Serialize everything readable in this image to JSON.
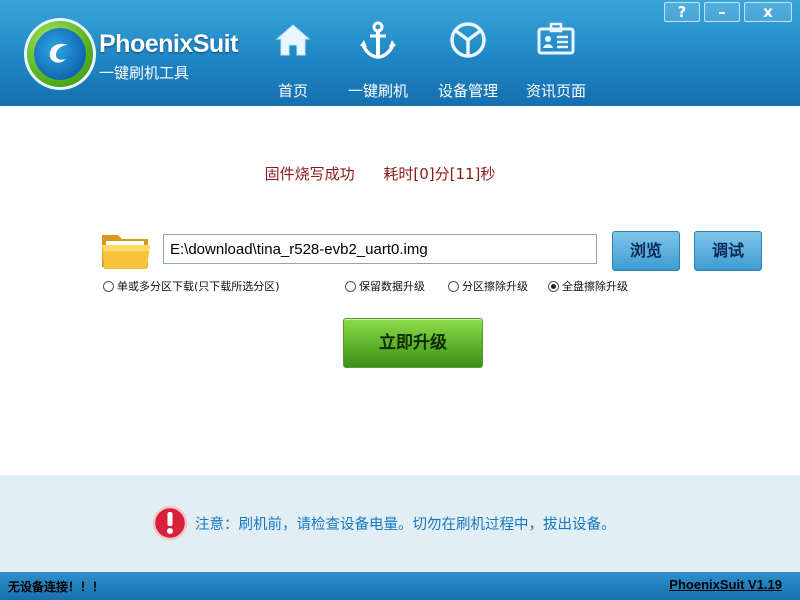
{
  "window": {
    "help_label": "?",
    "minimize_label": "–",
    "close_label": "x"
  },
  "brand": {
    "name": "PhoenixSuit",
    "subtitle": "一键刷机工具"
  },
  "nav": {
    "items": [
      {
        "label": "首页",
        "icon": "home-icon"
      },
      {
        "label": "一键刷机",
        "icon": "anchor-icon"
      },
      {
        "label": "设备管理",
        "icon": "device-icon"
      },
      {
        "label": "资讯页面",
        "icon": "news-icon"
      }
    ]
  },
  "status": {
    "result": "固件烧写成功",
    "elapsed": "耗时[0]分[11]秒",
    "color": "#8b1a1a"
  },
  "firmware": {
    "path": "E:\\download\\tina_r528-evb2_uart0.img",
    "browse_label": "浏览",
    "debug_label": "调试"
  },
  "options": {
    "partition_download": {
      "label": "单或多分区下载(只下载所选分区)",
      "checked": false
    },
    "keep_data": {
      "label": "保留数据升级",
      "checked": false
    },
    "partition_erase": {
      "label": "分区擦除升级",
      "checked": false
    },
    "full_erase": {
      "label": "全盘擦除升级",
      "checked": true
    }
  },
  "upgrade": {
    "label": "立即升级"
  },
  "notice": {
    "text": "注意：刷机前，请检查设备电量。切勿在刷机过程中，拔出设备。"
  },
  "footer": {
    "device_status": "无设备连接！！！",
    "version": "PhoenixSuit V1.19"
  },
  "colors": {
    "header": "#1f86c4",
    "accent_green": "#5cb22a",
    "notice_blue": "#1877c2"
  }
}
